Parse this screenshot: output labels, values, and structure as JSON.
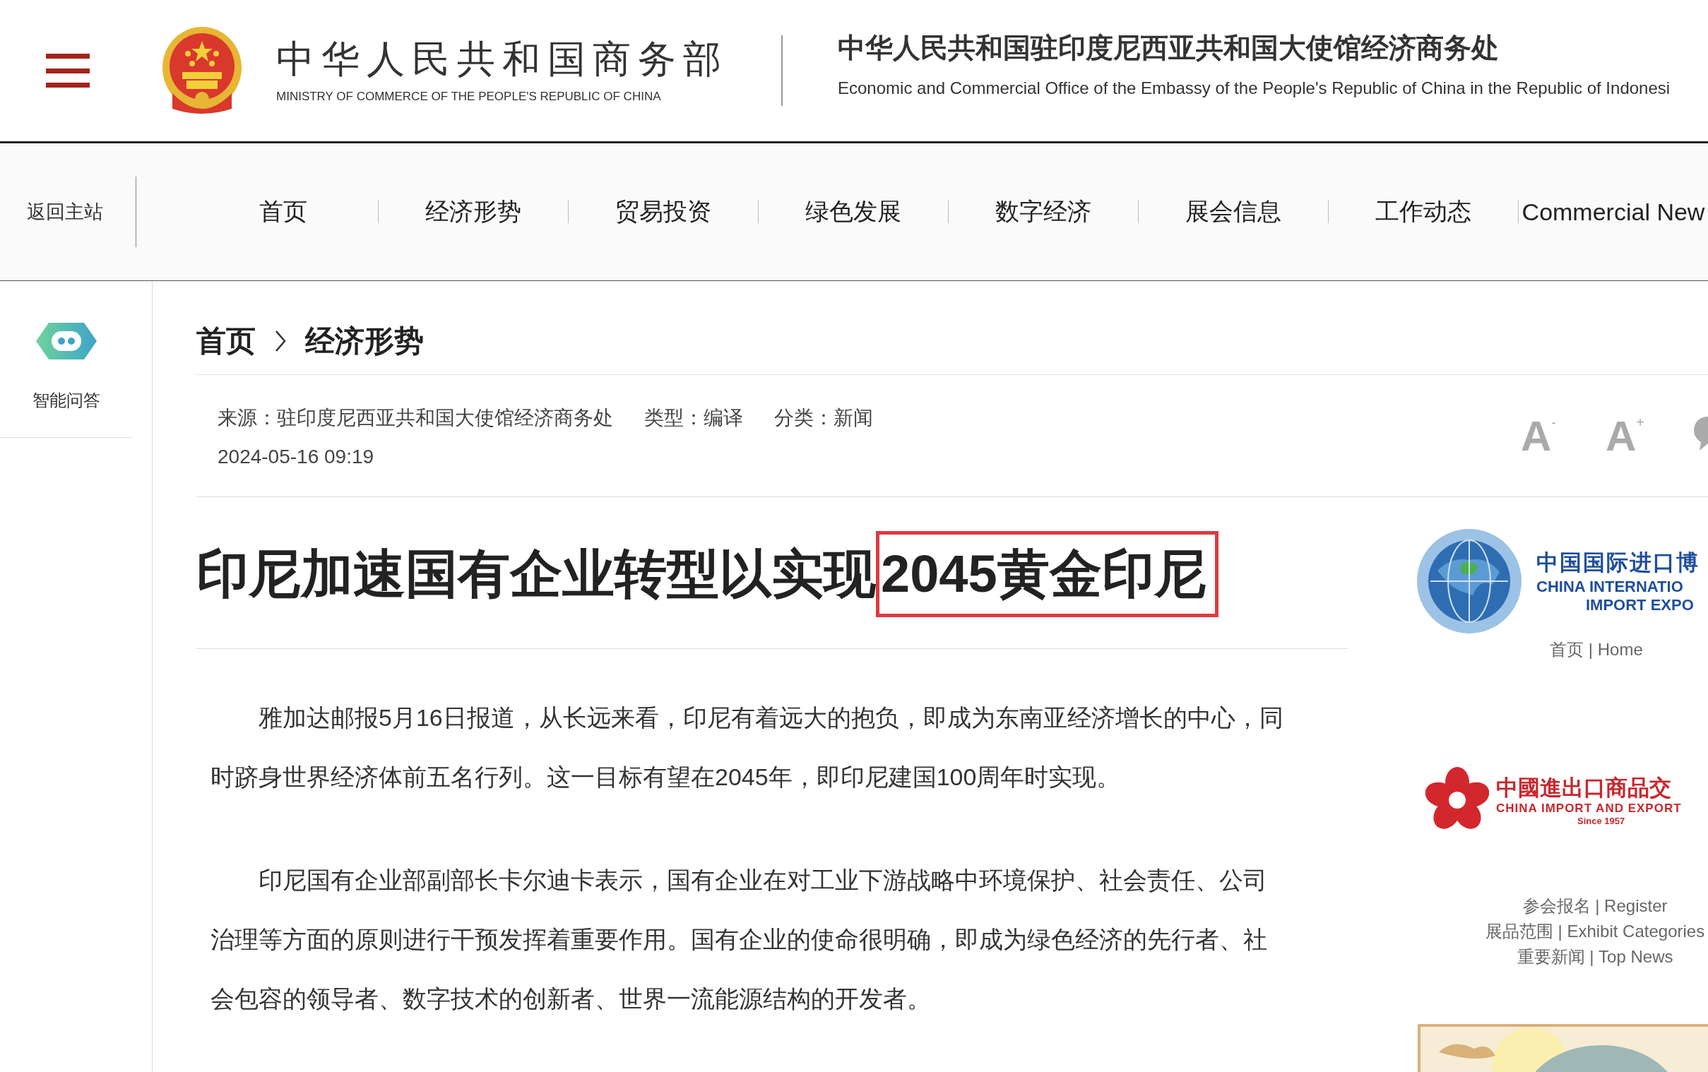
{
  "header": {
    "ministry_name_cn": "中华人民共和国商务部",
    "ministry_name_en": "MINISTRY OF COMMERCE OF THE PEOPLE'S REPUBLIC OF CHINA",
    "office_name_cn": "中华人民共和国驻印度尼西亚共和国大使馆经济商务处",
    "office_name_en": "Economic and Commercial Office of the Embassy of the People's Republic of China in the Republic of Indonesi"
  },
  "nav": {
    "back_link": "返回主站",
    "items": [
      {
        "label": "首页"
      },
      {
        "label": "经济形势"
      },
      {
        "label": "贸易投资"
      },
      {
        "label": "绿色发展"
      },
      {
        "label": "数字经济"
      },
      {
        "label": "展会信息"
      },
      {
        "label": "工作动态"
      },
      {
        "label": "Commercial New"
      }
    ]
  },
  "assistant": {
    "label": "智能问答"
  },
  "breadcrumb": [
    "首页",
    "经济形势"
  ],
  "meta": {
    "source": "来源：驻印度尼西亚共和国大使馆经济商务处",
    "type": "类型：编译",
    "category": "分类：新闻",
    "date": "2024-05-16 09:19"
  },
  "font_size_buttons": [
    {
      "label": "A",
      "sign": "-"
    },
    {
      "label": "A",
      "sign": "+"
    }
  ],
  "article": {
    "title": "印尼加速国有企业转型以实现",
    "title_highlighted": "2045黄金印尼",
    "paragraphs": [
      "雅加达邮报5月16日报道，从长远来看，印尼有着远大的抱负，即成为东南亚经济增长的中心，同时跻身世界经济体前五名行列。这一目标有望在2045年，即印尼建国100周年时实现。",
      "印尼国有企业部副部长卡尔迪卡表示，国有企业在对工业下游战略中环境保护、社会责任、公司治理等方面的原则进行干预发挥着重要作用。国有企业的使命很明确，即成为绿色经济的先行者、社会包容的领导者、数字技术的创新者、世界一流能源结构的开发者。"
    ]
  },
  "sidebar": {
    "ciie": {
      "name_cn": "中国国际进口博",
      "name_en_1": "CHINA INTERNATIO",
      "name_en_2": "IMPORT EXPO",
      "link": "首页 | Home"
    },
    "canton_fair": {
      "name_cn": "中國進出口商品交",
      "name_en": "CHINA IMPORT AND EXPORT",
      "since": "Since 1957"
    },
    "links": [
      "参会报名 | Register",
      "展品范围 | Exhibit Categories",
      "重要新闻 | Top News"
    ]
  }
}
